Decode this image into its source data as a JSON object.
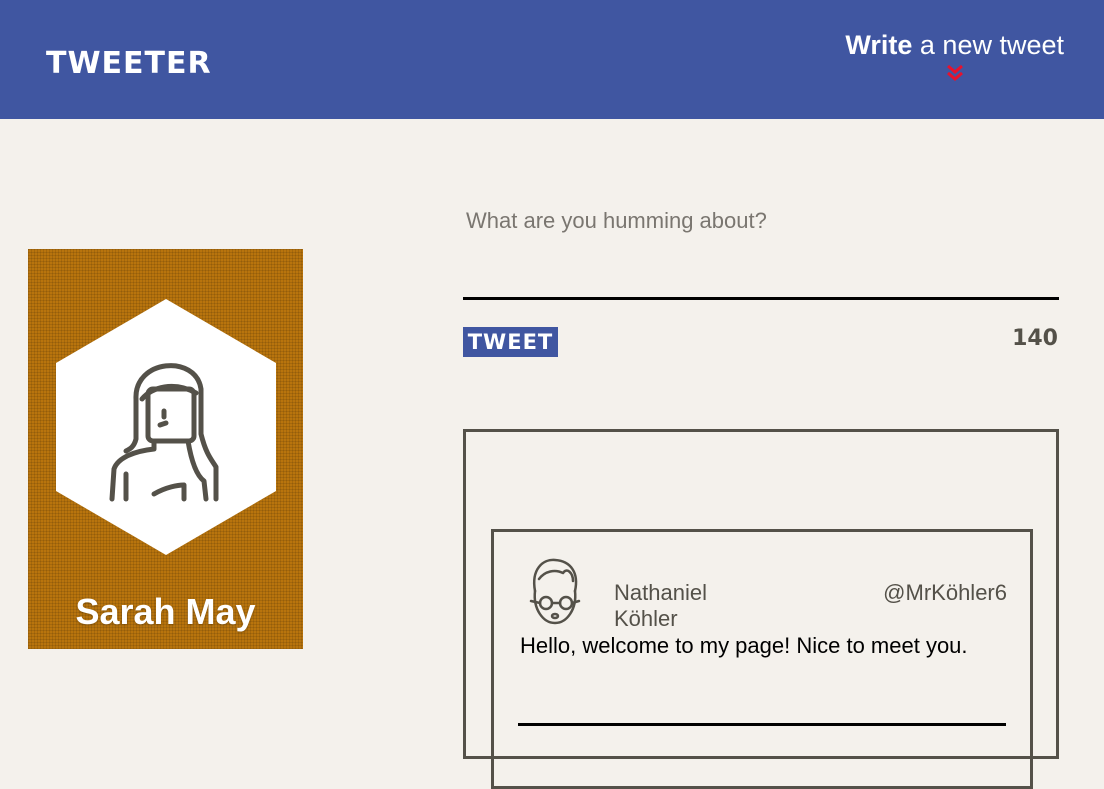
{
  "header": {
    "logo": "TWEETER",
    "compose_toggle": {
      "strong": "Write",
      "rest": " a new tweet",
      "icon": "double-chevron-down-icon",
      "icon_color": "#e8112d"
    }
  },
  "colors": {
    "header_bg": "#4056a1",
    "page_bg": "#f4f1ec",
    "profile_card_bg": "#b8740d",
    "text_dark": "#545149"
  },
  "profile": {
    "name": "Sarah May",
    "avatar": "woman-avatar-icon"
  },
  "compose": {
    "placeholder": "What are you humming about?",
    "value": "",
    "button_label": "TWEET",
    "counter": "140"
  },
  "tweets": [
    {
      "name": "Nathaniel Köhler",
      "handle": "@MrKöhler6",
      "avatar": "man-with-glasses-avatar-icon",
      "body": "Hello, welcome to my page! Nice to meet you."
    }
  ]
}
